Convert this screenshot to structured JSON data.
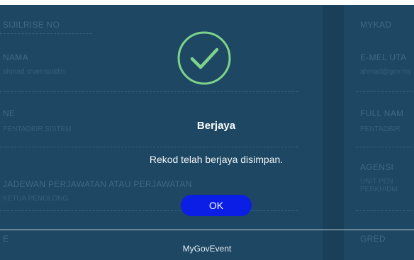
{
  "background_form": {
    "left_fields": [
      {
        "label": "SIJILRISE NO",
        "value": ""
      },
      {
        "label": "NAMA",
        "value": "ahmad.shamsuddin"
      },
      {
        "label": "NE",
        "value": "PENTADBIR SISTEM"
      },
      {
        "label": "JADEWAN PERJAWATAN ATAU PERJAWATAN",
        "value": "KETUA PENOLONG"
      },
      {
        "label": "E",
        "value": ""
      }
    ],
    "right_fields": [
      {
        "label": "MYKAD",
        "value": ""
      },
      {
        "label": "E-MEL UTA",
        "value": "ahmad@gov.my"
      },
      {
        "label": "FULL NAM",
        "value": "PENTADBIR"
      },
      {
        "label": "AGENSI",
        "value": "UNIT PEN\nPERKHIDM"
      },
      {
        "label": "GRED",
        "value": ""
      }
    ]
  },
  "modal": {
    "icon": "check-circle-icon",
    "title": "Berjaya",
    "message": "Rekod telah berjaya disimpan.",
    "ok_label": "OK"
  },
  "footer": {
    "text": "MyGovEvent"
  },
  "colors": {
    "overlay_background": "#1d4762",
    "check_color": "#7ed38a",
    "ok_button": "#0a1ee6"
  }
}
